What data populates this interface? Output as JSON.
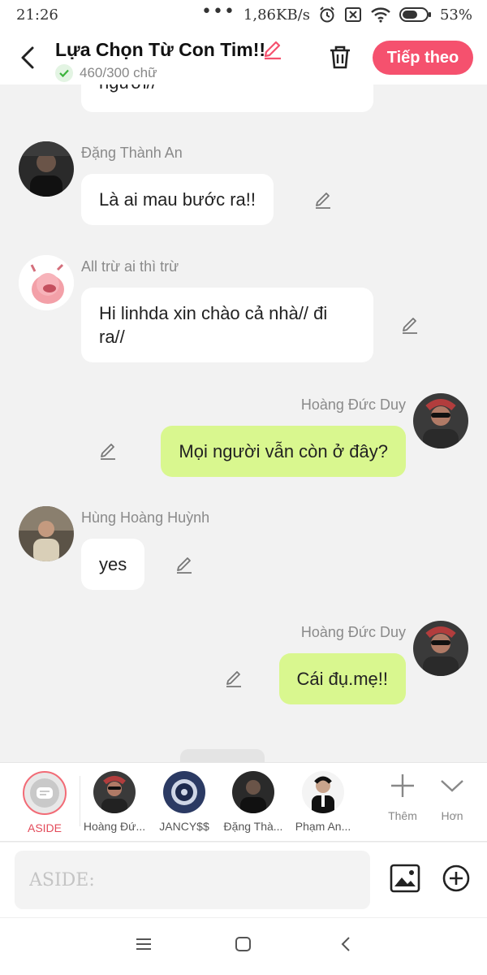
{
  "status_bar": {
    "time": "21:26",
    "network_speed": "1,86KB/s",
    "battery": "53%",
    "icons": [
      "more-dots-icon",
      "alarm-icon",
      "no-sim-icon",
      "wifi-icon",
      "battery-icon"
    ]
  },
  "header": {
    "title": "Lựa Chọn Từ Con Tim!!",
    "char_count": "460/300 chữ",
    "next_button": "Tiếp theo"
  },
  "messages": [
    {
      "side": "left",
      "name": "",
      "text": "người//"
    },
    {
      "side": "left",
      "name": "Đặng Thành An",
      "text": "Là ai mau bước ra!!"
    },
    {
      "side": "left",
      "name": "All trừ ai thì trừ",
      "text": "Hi linhda xin chào cả nhà// đi ra//"
    },
    {
      "side": "right",
      "name": "Hoàng Đức Duy",
      "text": "Mọi người vẫn còn ở đây?"
    },
    {
      "side": "left",
      "name": "Hùng Hoàng Huỳnh",
      "text": "yes"
    },
    {
      "side": "right",
      "name": "Hoàng Đức Duy",
      "text": "Cái đụ.mẹ!!"
    }
  ],
  "characters": [
    {
      "label": "ASIDE",
      "selected": true
    },
    {
      "label": "Hoàng Đứ..."
    },
    {
      "label": "JANCY$$"
    },
    {
      "label": "Đặng Thà..."
    },
    {
      "label": "Phạm An..."
    }
  ],
  "tools": {
    "add_label": "Thêm",
    "more_label": "Hơn"
  },
  "input": {
    "placeholder": "ASIDE:"
  },
  "colors": {
    "accent": "#f5516e",
    "right_bubble": "#d9f78f",
    "aside_ring": "#f26b76"
  }
}
